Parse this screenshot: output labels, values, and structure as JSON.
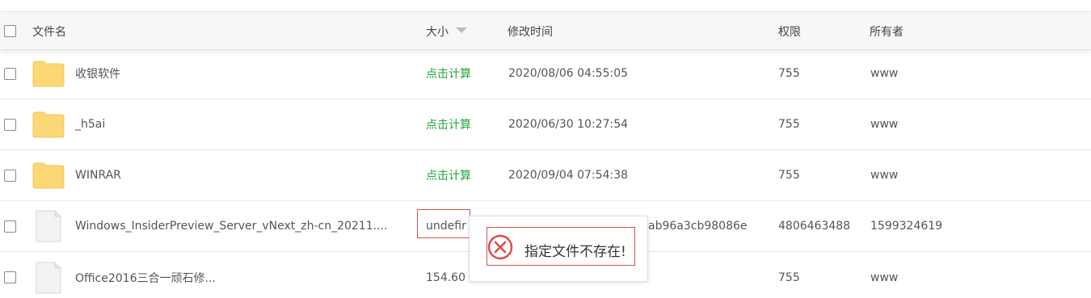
{
  "header": {
    "name_label": "文件名",
    "size_label": "大小",
    "mtime_label": "修改时间",
    "perm_label": "权限",
    "owner_label": "所有者",
    "sort_icon": "sort-desc-icon"
  },
  "rows": [
    {
      "type": "folder",
      "name": "收银软件",
      "size": "点击计算",
      "mtime": "2020/08/06 04:55:05",
      "perm": "755",
      "owner": "www"
    },
    {
      "type": "folder",
      "name": "_h5ai",
      "size": "点击计算",
      "mtime": "2020/06/30 10:27:54",
      "perm": "755",
      "owner": "www"
    },
    {
      "type": "folder",
      "name": "WINRAR",
      "size": "点击计算",
      "mtime": "2020/09/04 07:54:38",
      "perm": "755",
      "owner": "www"
    },
    {
      "type": "file",
      "name": "Windows_InsiderPreview_Server_vNext_zh-cn_20211....",
      "size": "undefir",
      "mtime": "ab96a3cb98086e",
      "perm": "4806463488",
      "owner": "1599324619"
    },
    {
      "type": "file",
      "name": "Office2016三合一顽石修...",
      "size": "154.60",
      "mtime": "",
      "perm": "755",
      "owner": "www"
    }
  ],
  "dialog": {
    "message": "指定文件不存在!",
    "icon": "error-circle-icon",
    "color": "#e04b4b"
  },
  "colors": {
    "calc_link": "#20a53a",
    "folder": "#fbd875",
    "error_border": "#d9534f"
  }
}
